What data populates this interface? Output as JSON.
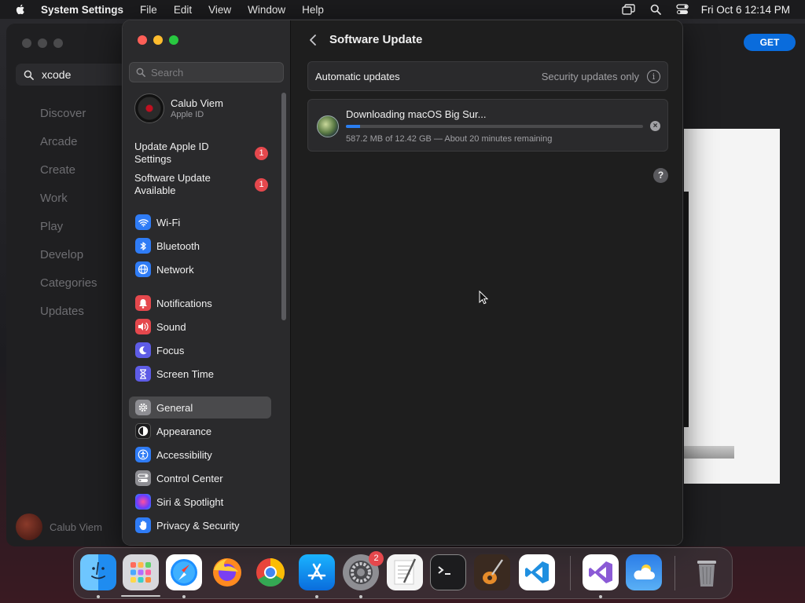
{
  "menubar": {
    "app_name": "System Settings",
    "menus": [
      "File",
      "Edit",
      "View",
      "Window",
      "Help"
    ],
    "clock": "Fri Oct 6  12:14 PM"
  },
  "appstore": {
    "search_value": "xcode",
    "nav": [
      "Discover",
      "Arcade",
      "Create",
      "Work",
      "Play",
      "Develop",
      "Categories",
      "Updates"
    ],
    "user_name": "Calub Viem",
    "get_label": "GET"
  },
  "sidebar": {
    "search_placeholder": "Search",
    "account_name": "Calub Viem",
    "account_sub": "Apple ID",
    "notices": [
      {
        "label": "Update Apple ID Settings",
        "badge": "1"
      },
      {
        "label": "Software Update Available",
        "badge": "1"
      }
    ],
    "items": [
      {
        "label": "Wi-Fi",
        "icon": "wifi-icon",
        "color": "#2f7cf6"
      },
      {
        "label": "Bluetooth",
        "icon": "bluetooth-icon",
        "color": "#2f7cf6"
      },
      {
        "label": "Network",
        "icon": "globe-icon",
        "color": "#2f7cf6"
      },
      {
        "label": "Notifications",
        "icon": "bell-icon",
        "color": "#e5484d"
      },
      {
        "label": "Sound",
        "icon": "speaker-icon",
        "color": "#e5484d"
      },
      {
        "label": "Focus",
        "icon": "moon-icon",
        "color": "#5e5ce6"
      },
      {
        "label": "Screen Time",
        "icon": "hourglass-icon",
        "color": "#5e5ce6"
      },
      {
        "label": "General",
        "icon": "gear-icon",
        "color": "#8e8e93"
      },
      {
        "label": "Appearance",
        "icon": "appearance-icon",
        "color": "#1c1c1e"
      },
      {
        "label": "Accessibility",
        "icon": "accessibility-icon",
        "color": "#2f7cf6"
      },
      {
        "label": "Control Center",
        "icon": "control-center-icon",
        "color": "#8e8e93"
      },
      {
        "label": "Siri & Spotlight",
        "icon": "siri-icon",
        "color": "#b04adf"
      },
      {
        "label": "Privacy & Security",
        "icon": "hand-icon",
        "color": "#2f7cf6"
      }
    ],
    "selected": "General"
  },
  "main": {
    "title": "Software Update",
    "auto_label": "Automatic updates",
    "auto_value": "Security updates only",
    "download_title": "Downloading macOS Big Sur...",
    "download_status": "587.2 MB of 12.42 GB — About 20 minutes remaining",
    "download_progress": 0.047
  },
  "dock": {
    "apps": [
      "Finder",
      "Launchpad",
      "Safari",
      "Firefox",
      "Chrome",
      "App Store",
      "System Settings",
      "TextEdit",
      "Terminal",
      "GarageBand",
      "Visual Studio Code",
      "Visual Studio",
      "Weather",
      "Trash"
    ],
    "settings_badge": "2"
  }
}
